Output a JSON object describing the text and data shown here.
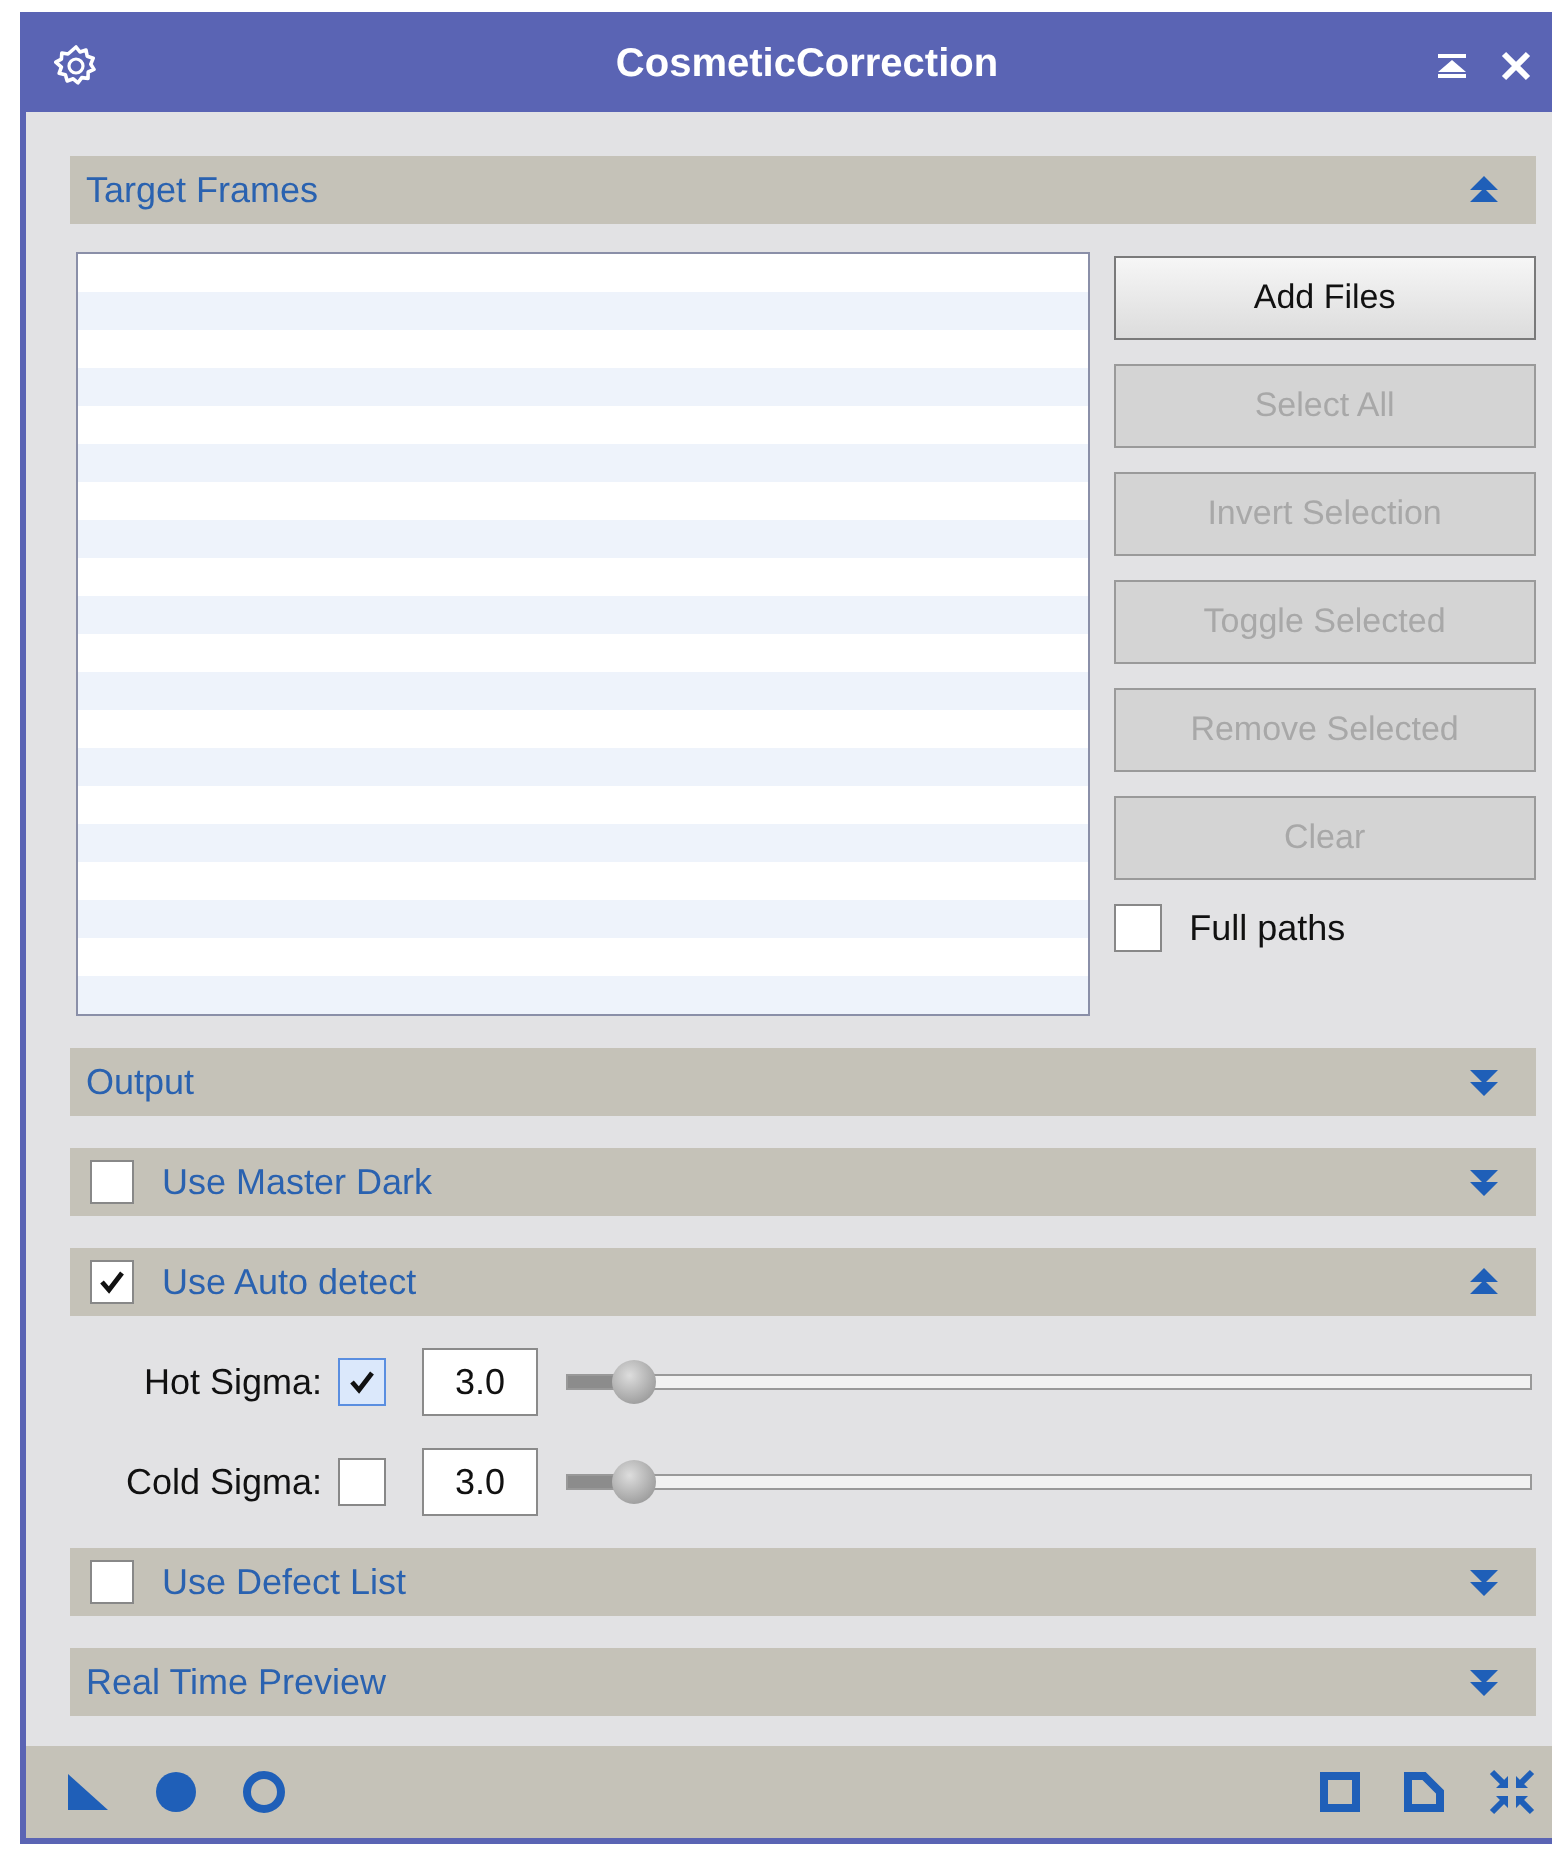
{
  "window": {
    "title": "CosmeticCorrection"
  },
  "target_frames": {
    "header": {
      "label": "Target Frames",
      "kind": "plain",
      "expanded": true
    },
    "buttons": [
      {
        "label": "Add Files",
        "disabled": false
      },
      {
        "label": "Select All",
        "disabled": true
      },
      {
        "label": "Invert Selection",
        "disabled": true
      },
      {
        "label": "Toggle Selected",
        "disabled": true
      },
      {
        "label": "Remove Selected",
        "disabled": true
      },
      {
        "label": "Clear",
        "disabled": true
      }
    ],
    "full_paths": {
      "label": "Full paths",
      "checked": false
    }
  },
  "sections": [
    {
      "label": "Output",
      "kind": "plain",
      "expanded": false
    },
    {
      "label": "Use Master Dark",
      "kind": "checkbox",
      "checked": false,
      "expanded": false
    },
    {
      "label": "Use Auto detect",
      "kind": "checkbox",
      "checked": true,
      "expanded": true,
      "rows": [
        {
          "label": "Hot Sigma:",
          "checked": true,
          "value": "3.0",
          "level": 0.07
        },
        {
          "label": "Cold Sigma:",
          "checked": false,
          "value": "3.0",
          "level": 0.07
        }
      ]
    },
    {
      "label": "Use Defect List",
      "kind": "checkbox",
      "checked": false,
      "expanded": false
    },
    {
      "label": "Real Time Preview",
      "kind": "plain",
      "expanded": false
    }
  ]
}
